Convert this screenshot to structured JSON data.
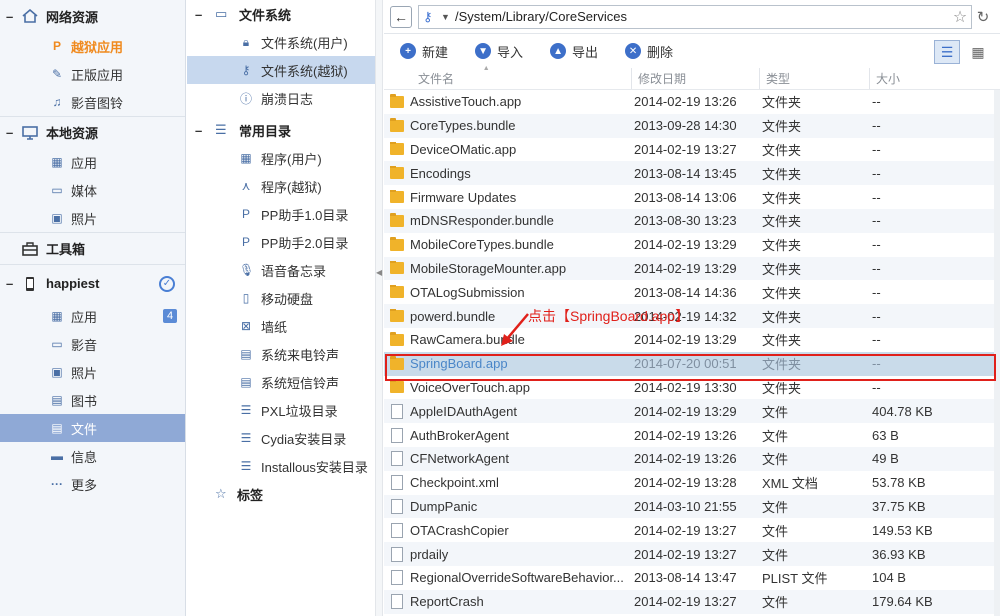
{
  "sidebar": {
    "groups": [
      {
        "label": "网络资源",
        "items": [
          {
            "label": "越狱应用",
            "icon": "pp-icon"
          },
          {
            "label": "正版应用",
            "icon": "app-store-icon"
          },
          {
            "label": "影音图铃",
            "icon": "music-note-icon"
          }
        ]
      },
      {
        "label": "本地资源",
        "items": [
          {
            "label": "应用",
            "icon": "grid-icon"
          },
          {
            "label": "媒体",
            "icon": "video-icon"
          },
          {
            "label": "照片",
            "icon": "photo-icon"
          }
        ]
      },
      {
        "label": "工具箱",
        "items": []
      },
      {
        "label": "happiest",
        "items": [
          {
            "label": "应用",
            "icon": "grid-icon",
            "badge": "4"
          },
          {
            "label": "影音",
            "icon": "video-icon"
          },
          {
            "label": "照片",
            "icon": "photo-icon"
          },
          {
            "label": "图书",
            "icon": "book-icon"
          },
          {
            "label": "文件",
            "icon": "file-icon"
          },
          {
            "label": "信息",
            "icon": "message-icon"
          },
          {
            "label": "更多",
            "icon": "more-icon"
          }
        ]
      }
    ]
  },
  "tree": {
    "fs_group": "文件系统",
    "fs_items": [
      "文件系统(用户)",
      "文件系统(越狱)",
      "崩溃日志"
    ],
    "common_group": "常用目录",
    "common_items": [
      "程序(用户)",
      "程序(越狱)",
      "PP助手1.0目录",
      "PP助手2.0目录",
      "语音备忘录",
      "移动硬盘",
      "墙纸",
      "系统来电铃声",
      "系统短信铃声",
      "PXL垃圾目录",
      "Cydia安装目录",
      "Installous安装目录"
    ],
    "tags_group": "标签"
  },
  "address": {
    "path": "/System/Library/CoreServices"
  },
  "toolbar": {
    "new": "新建",
    "import": "导入",
    "export": "导出",
    "delete": "删除"
  },
  "columns": {
    "name": "文件名",
    "modified": "修改日期",
    "type": "类型",
    "size": "大小"
  },
  "files": [
    {
      "name": "AssistiveTouch.app",
      "date": "2014-02-19 13:26",
      "type": "文件夹",
      "size": "--",
      "folder": true
    },
    {
      "name": "CoreTypes.bundle",
      "date": "2013-09-28 14:30",
      "type": "文件夹",
      "size": "--",
      "folder": true
    },
    {
      "name": "DeviceOMatic.app",
      "date": "2014-02-19 13:27",
      "type": "文件夹",
      "size": "--",
      "folder": true
    },
    {
      "name": "Encodings",
      "date": "2013-08-14 13:45",
      "type": "文件夹",
      "size": "--",
      "folder": true
    },
    {
      "name": "Firmware Updates",
      "date": "2013-08-14 13:06",
      "type": "文件夹",
      "size": "--",
      "folder": true
    },
    {
      "name": "mDNSResponder.bundle",
      "date": "2013-08-30 13:23",
      "type": "文件夹",
      "size": "--",
      "folder": true
    },
    {
      "name": "MobileCoreTypes.bundle",
      "date": "2014-02-19 13:29",
      "type": "文件夹",
      "size": "--",
      "folder": true
    },
    {
      "name": "MobileStorageMounter.app",
      "date": "2014-02-19 13:29",
      "type": "文件夹",
      "size": "--",
      "folder": true
    },
    {
      "name": "OTALogSubmission",
      "date": "2013-08-14 14:36",
      "type": "文件夹",
      "size": "--",
      "folder": true
    },
    {
      "name": "powerd.bundle",
      "date": "2014-02-19 14:32",
      "type": "文件夹",
      "size": "--",
      "folder": true
    },
    {
      "name": "RawCamera.bundle",
      "date": "2014-02-19 13:29",
      "type": "文件夹",
      "size": "--",
      "folder": true
    },
    {
      "name": "SpringBoard.app",
      "date": "2014-07-20 00:51",
      "type": "文件夹",
      "size": "--",
      "folder": true,
      "highlight": true
    },
    {
      "name": "VoiceOverTouch.app",
      "date": "2014-02-19 13:30",
      "type": "文件夹",
      "size": "--",
      "folder": true
    },
    {
      "name": "AppleIDAuthAgent",
      "date": "2014-02-19 13:29",
      "type": "文件",
      "size": "404.78 KB",
      "folder": false
    },
    {
      "name": "AuthBrokerAgent",
      "date": "2014-02-19 13:26",
      "type": "文件",
      "size": "63 B",
      "folder": false
    },
    {
      "name": "CFNetworkAgent",
      "date": "2014-02-19 13:26",
      "type": "文件",
      "size": "49 B",
      "folder": false
    },
    {
      "name": "Checkpoint.xml",
      "date": "2014-02-19 13:28",
      "type": "XML 文档",
      "size": "53.78 KB",
      "folder": false
    },
    {
      "name": "DumpPanic",
      "date": "2014-03-10 21:55",
      "type": "文件",
      "size": "37.75 KB",
      "folder": false
    },
    {
      "name": "OTACrashCopier",
      "date": "2014-02-19 13:27",
      "type": "文件",
      "size": "149.53 KB",
      "folder": false
    },
    {
      "name": "prdaily",
      "date": "2014-02-19 13:27",
      "type": "文件",
      "size": "36.93 KB",
      "folder": false
    },
    {
      "name": "RegionalOverrideSoftwareBehavior...",
      "date": "2013-08-14 13:47",
      "type": "PLIST 文件",
      "size": "104 B",
      "folder": false
    },
    {
      "name": "ReportCrash",
      "date": "2014-02-19 13:27",
      "type": "文件",
      "size": "179.64 KB",
      "folder": false
    }
  ],
  "annotation": "点击【SpringBoard.app】"
}
